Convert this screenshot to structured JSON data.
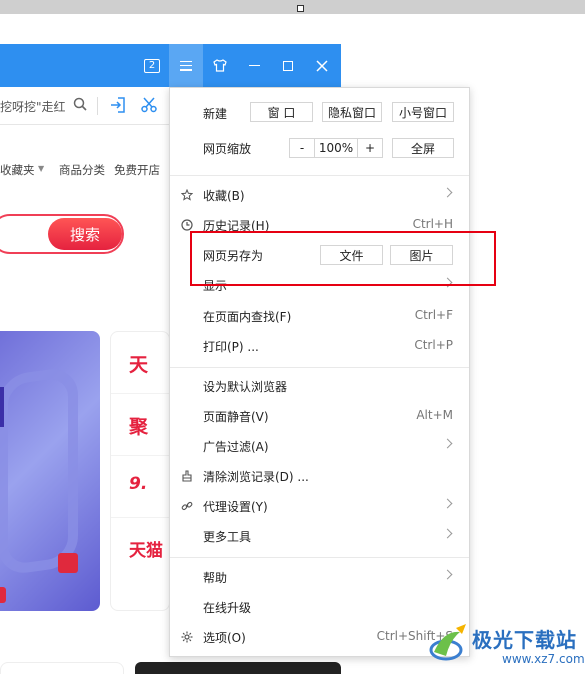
{
  "titlebar": {
    "tab_count": "2"
  },
  "address_bar": {
    "text": "挖呀挖\"走红"
  },
  "favorites_bar": {
    "items": [
      "收藏夹",
      "商品分类",
      "免费开店"
    ]
  },
  "page": {
    "search_button": "搜索",
    "promo_rows": [
      "天",
      "聚",
      "9.",
      "天猫"
    ]
  },
  "menu": {
    "new_label": "新建",
    "new_buttons": [
      "窗 口",
      "隐私窗口",
      "小号窗口"
    ],
    "zoom_label": "网页缩放",
    "zoom_minus": "-",
    "zoom_value": "100%",
    "zoom_plus": "+",
    "fullscreen": "全屏",
    "favorites": "收藏(B)",
    "history": "历史记录(H)",
    "history_shortcut": "Ctrl+H",
    "save_as_label": "网页另存为",
    "save_as_file": "文件",
    "save_as_image": "图片",
    "display": "显示",
    "find": "在页面内查找(F)",
    "find_shortcut": "Ctrl+F",
    "print": "打印(P) ...",
    "print_shortcut": "Ctrl+P",
    "set_default": "设为默认浏览器",
    "mute": "页面静音(V)",
    "mute_shortcut": "Alt+M",
    "ad_filter": "广告过滤(A)",
    "clear_records": "清除浏览记录(D) ...",
    "proxy": "代理设置(Y)",
    "more_tools": "更多工具",
    "help": "帮助",
    "online_upgrade": "在线升级",
    "options": "选项(O)",
    "options_shortcut": "Ctrl+Shift+S"
  },
  "watermark": {
    "name": "极光下载站",
    "url": "www.xz7.com"
  },
  "colors": {
    "titlebar_blue": "#2e8ff0",
    "highlight_red": "#e60012",
    "search_red": "#f03f56"
  }
}
